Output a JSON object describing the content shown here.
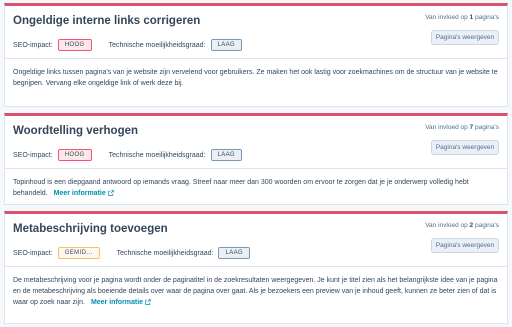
{
  "common": {
    "seo_impact_label": "SEO-impact:",
    "difficulty_label": "Technische moeilijkheidsgraad:",
    "view_pages_label": "Pagina's weergeven",
    "more_info_label": "Meer informatie",
    "impact_prefix": "Van invloed op",
    "impact_suffix": "pagina's"
  },
  "cards": [
    {
      "title": "Ongeldige interne links corrigeren",
      "seo_impact": "HOOG",
      "difficulty": "LAAG",
      "pages_count": "1",
      "description": "Ongeldige links tussen pagina's van je website zijn vervelend voor gebruikers. Ze maken het ook lastig voor zoekmachines om de structuur van je website te begrijpen. Vervang elke ongeldige link of werk deze bij."
    },
    {
      "title": "Woordtelling verhogen",
      "seo_impact": "HOOG",
      "difficulty": "LAAG",
      "pages_count": "7",
      "description": "Topinhoud is een diepgaand antwoord op iemands vraag. Streef naar meer dan 300 woorden om ervoor te zorgen dat je je onderwerp volledig hebt behandeld."
    },
    {
      "title": "Metabeschrijving toevoegen",
      "seo_impact": "GEMID...",
      "difficulty": "LAAG",
      "pages_count": "2",
      "description": "De metabeschrijving voor je pagina wordt onder de paginatitel in de zoekresultaten weergegeven. Je kunt je titel zien als het belangrijkste idee van je pagina en de metabeschrijving als boeiende details over waar de pagina over gaat. Als je bezoekers een preview van je inhoud geeft, kunnen ze beter zien of dat is waar op zoek naar zijn."
    }
  ],
  "colors": {
    "accent_top_border": "#d9536f",
    "link": "#0091ae"
  }
}
